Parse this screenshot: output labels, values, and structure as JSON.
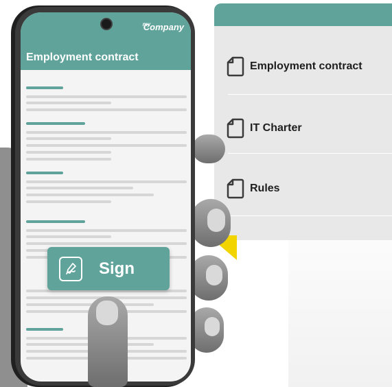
{
  "phone": {
    "brand_small": "my",
    "brand": "Company",
    "title": "Employment contract",
    "sign_button": "Sign"
  },
  "documents": [
    {
      "label": "Employment contract",
      "icon": "document-icon"
    },
    {
      "label": "IT Charter",
      "icon": "document-icon"
    },
    {
      "label": "Rules",
      "icon": "document-icon"
    }
  ],
  "colors": {
    "accent": "#5fa39a",
    "panel": "#e9e8e8",
    "highlight": "#f2d400"
  }
}
